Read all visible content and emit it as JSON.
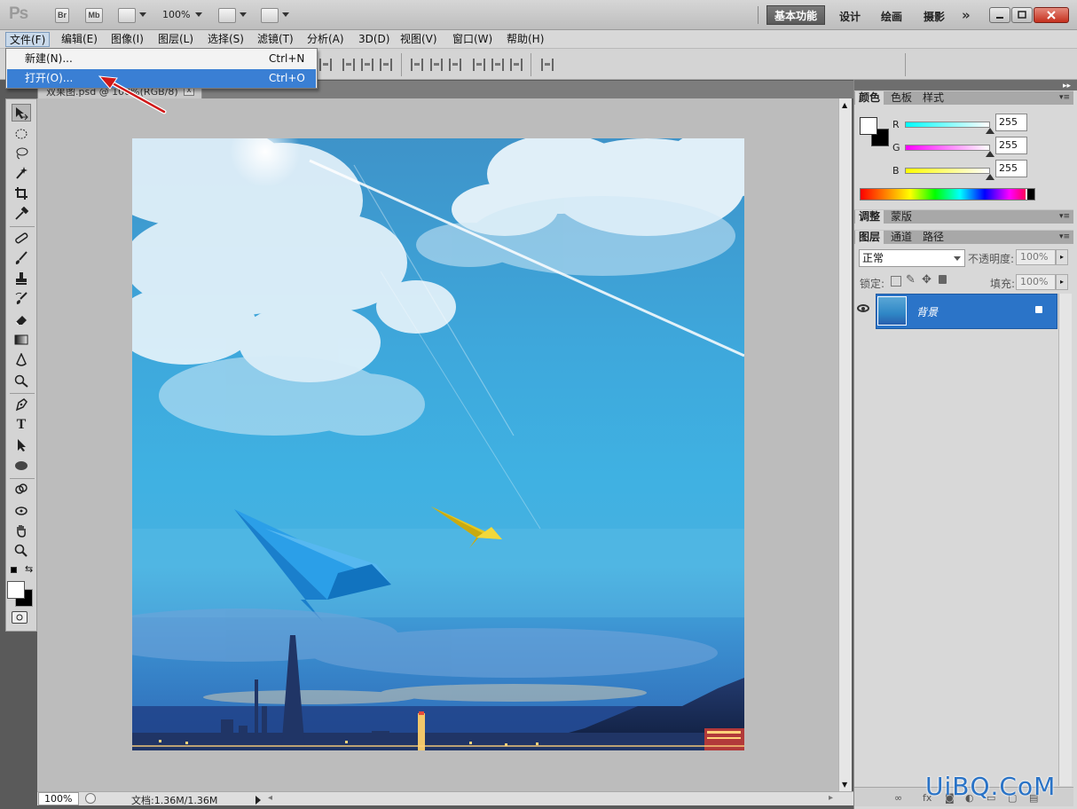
{
  "appbar": {
    "logo": "Ps",
    "bridge_label": "Br",
    "minibridge_label": "Mb",
    "zoom": "100%",
    "workspaces": [
      "基本功能",
      "设计",
      "绘画",
      "摄影"
    ],
    "more": "»"
  },
  "menu": {
    "items": [
      "文件(F)",
      "编辑(E)",
      "图像(I)",
      "图层(L)",
      "选择(S)",
      "滤镜(T)",
      "分析(A)",
      "3D(D)",
      "视图(V)",
      "窗口(W)",
      "帮助(H)"
    ],
    "active_index": 0
  },
  "file_menu": {
    "items": [
      {
        "label": "新建(N)...",
        "shortcut": "Ctrl+N"
      },
      {
        "label": "打开(O)...",
        "shortcut": "Ctrl+O",
        "highlighted": true
      }
    ]
  },
  "document": {
    "tab_label": "双果图.psd @ 100%(RGB/8)",
    "close_label": "x",
    "zoom_field": "100%",
    "doc_info": "文档:1.36M/1.36M"
  },
  "color_panel": {
    "tabs": [
      "颜色",
      "色板",
      "样式"
    ],
    "channels": [
      {
        "name": "R",
        "value": "255"
      },
      {
        "name": "G",
        "value": "255"
      },
      {
        "name": "B",
        "value": "255"
      }
    ]
  },
  "adjust_panel": {
    "tabs": [
      "调整",
      "蒙版"
    ]
  },
  "layers_panel": {
    "tabs": [
      "图层",
      "通道",
      "路径"
    ],
    "blend_mode": "正常",
    "opacity_label": "不透明度:",
    "opacity_value": "100%",
    "lock_label": "锁定:",
    "fill_label": "填充:",
    "fill_value": "100%",
    "layer_name": "背景"
  },
  "watermark": "UiBQ.CoM",
  "colors": {
    "accent": "#3a7fd4",
    "layer_selected": "#2b74c8",
    "sky": "#3fb1e2",
    "plane_blue": "#1e8fe0",
    "plane_yellow": "#e4c21a"
  }
}
